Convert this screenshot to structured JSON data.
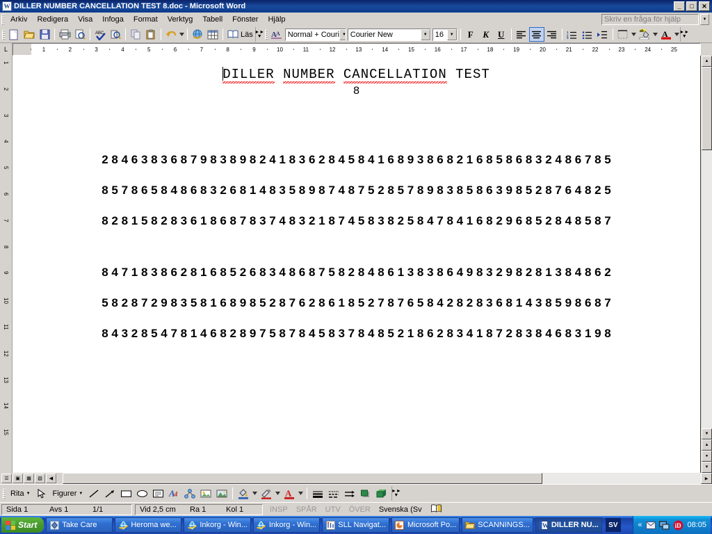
{
  "window": {
    "title": "DILLER NUMBER CANCELLATION TEST 8.doc - Microsoft Word",
    "app_icon": "word-icon",
    "minimize_label": "_",
    "maximize_label": "□",
    "close_label": "✕"
  },
  "menubar": {
    "items": [
      {
        "label": "Arkiv"
      },
      {
        "label": "Redigera"
      },
      {
        "label": "Visa"
      },
      {
        "label": "Infoga"
      },
      {
        "label": "Format"
      },
      {
        "label": "Verktyg"
      },
      {
        "label": "Tabell"
      },
      {
        "label": "Fönster"
      },
      {
        "label": "Hjälp"
      }
    ],
    "help_placeholder": "Skriv en fråga för hjälp"
  },
  "toolbar": {
    "buttons": [
      {
        "name": "new-document-icon",
        "glyph": "⬜"
      },
      {
        "name": "open-folder-icon",
        "glyph": "📂"
      },
      {
        "name": "save-icon",
        "glyph": "💾"
      },
      {
        "name": "print-icon",
        "glyph": "🖨"
      },
      {
        "name": "print-preview-icon",
        "glyph": "🔍"
      },
      {
        "name": "spelling-check-icon",
        "glyph": "✔"
      },
      {
        "name": "research-icon",
        "glyph": "🔬"
      },
      {
        "name": "copy-icon",
        "glyph": "⧉"
      },
      {
        "name": "paste-icon",
        "glyph": "📋"
      },
      {
        "name": "undo-icon",
        "glyph": "↶"
      },
      {
        "name": "hyperlink-icon",
        "glyph": "🌐"
      },
      {
        "name": "table-icon",
        "glyph": "▦"
      }
    ],
    "read_label": "Läs",
    "style_value": "Normal + Couri",
    "font_value": "Courier New",
    "size_value": "16",
    "bold_label": "F",
    "italic_label": "K",
    "underline_label": "U",
    "align_left": "≡",
    "align_center": "≡",
    "align_right": "≡",
    "numbered_list": "≣",
    "bullet_list": "☰",
    "indent": "⇥",
    "borders": "▦",
    "highlight": "ab",
    "font_color": "A",
    "active_alignment": "center"
  },
  "ruler": {
    "marks": [
      "1",
      "2",
      "3",
      "4",
      "5",
      "6",
      "7",
      "8",
      "9",
      "10",
      "11",
      "12",
      "13",
      "14",
      "15",
      "16",
      "17",
      "18",
      "19",
      "20",
      "21",
      "22",
      "23",
      "24",
      "25"
    ],
    "vertical_marks": [
      "1",
      "2",
      "3",
      "4",
      "5",
      "6",
      "7",
      "8",
      "9",
      "10",
      "11",
      "12",
      "13",
      "14",
      "15"
    ]
  },
  "document": {
    "title_words": [
      {
        "text": "DILLER",
        "misspelled": true
      },
      {
        "text": "NUMBER",
        "misspelled": true
      },
      {
        "text": "CANCELLATION",
        "misspelled": true
      },
      {
        "text": "TEST",
        "misspelled": false
      }
    ],
    "title_plain": "DILLER NUMBER CANCELLATION TEST",
    "subtitle": "8",
    "rows": [
      "2 8 4 6 3 8 3 6 8 7 9 8 3 8 9 8 2 4 1 8 3 6 2 8 4 5 8 4 1 6 8 9 3 8 6 8 2 1 6 8 5 8 6 8 3 2 4 8 6 7 8 5",
      "8 5 7 8 6 5 8 4 8 6 8 3 2 6 8 1 4 8 3 5 8 9 8 7 4 8 7 5 2 8 5 7 8 9 8 3 8 5 8 6 3 9 8 5 2 8 7 6 4 8 2 5",
      "8 2 8 1 5 8 2 8 3 6 1 8 6 8 7 8 3 7 4 8 3 2 1 8 7 4 5 8 3 8 2 5 8 4 7 8 4 1 6 8 2 9 6 8 5 2 8 4 8 5 8 7",
      "8 4 7 1 8 3 8 6 2 8 1 6 8 5 2 6 8 3 4 8 6 8 7 5 8 2 8 4 8 6 1 3 8 3 8 6 4 9 8 3 2 9 8 2 8 1 3 8 4 8 6 2",
      "5 8 2 8 7 2 9 8 3 5 8 1 6 8 9 8 5 2 8 7 6 2 8 6 1 8 5 2 7 8 7 6 5 8 4 2 8 2 8 3 6 8 1 4 3 8 5 9 8 6 8 7",
      "8 4 3 2 8 5 4 7 8 1 4 6 8 2 8 9 7 5 8 7 8 4 5 8 3 7 8 4 8 5 2 1 8 6 2 8 3 4 1 8 7 2 8 3 8 4 6 8 3 1 9 8"
    ]
  },
  "drawing_toolbar": {
    "draw_label": "Rita",
    "shapes_label": "Figurer",
    "tools": [
      {
        "name": "select-arrow-icon",
        "glyph": "↖"
      },
      {
        "name": "line-icon",
        "glyph": "╲"
      },
      {
        "name": "arrow-icon",
        "glyph": "→"
      },
      {
        "name": "rectangle-icon",
        "glyph": "▭"
      },
      {
        "name": "oval-icon",
        "glyph": "◯"
      },
      {
        "name": "textbox-icon",
        "glyph": "▤"
      },
      {
        "name": "wordart-icon",
        "glyph": "𝑨"
      },
      {
        "name": "diagram-icon",
        "glyph": "⊞"
      },
      {
        "name": "clipart-icon",
        "glyph": "🖼"
      },
      {
        "name": "picture-icon",
        "glyph": "🏞"
      },
      {
        "name": "fill-color-icon",
        "glyph": "🪣"
      },
      {
        "name": "line-color-icon",
        "glyph": "✎"
      },
      {
        "name": "font-color-icon",
        "glyph": "A"
      },
      {
        "name": "line-style-icon",
        "glyph": "≡"
      },
      {
        "name": "dash-style-icon",
        "glyph": "☰"
      },
      {
        "name": "arrow-style-icon",
        "glyph": "⇥"
      },
      {
        "name": "shadow-style-icon",
        "glyph": "■"
      },
      {
        "name": "3d-style-icon",
        "glyph": "▣"
      }
    ]
  },
  "statusbar": {
    "page": "Sida 1",
    "section": "Avs 1",
    "pages": "1/1",
    "at": "Vid 2,5 cm",
    "line": "Ra 1",
    "column": "Kol 1",
    "insp": "INSP",
    "spar": "SPÅR",
    "utv": "UTV",
    "over": "ÖVER",
    "language": "Svenska (Sv",
    "spell_icon": "book-icon"
  },
  "taskbar": {
    "start_label": "Start",
    "items": [
      {
        "label": "Take Care",
        "icon": "takecare-icon",
        "active": false
      },
      {
        "label": "Heroma we...",
        "icon": "internet-explorer-icon",
        "active": false
      },
      {
        "label": "Inkorg - Win...",
        "icon": "internet-explorer-icon",
        "active": false
      },
      {
        "label": "Inkorg - Win...",
        "icon": "internet-explorer-icon",
        "active": false
      },
      {
        "label": "SLL Navigat...",
        "icon": "sll-icon",
        "active": false
      },
      {
        "label": "Microsoft Po...",
        "icon": "powerpoint-icon",
        "active": false
      },
      {
        "label": "SCANNINGS...",
        "icon": "folder-icon",
        "active": false
      },
      {
        "label": "DILLER NU...",
        "icon": "word-icon",
        "active": true
      }
    ],
    "language_indicator": "SV",
    "tray": {
      "expand": "«",
      "icons": [
        {
          "name": "mail-tray-icon",
          "glyph": "✉"
        },
        {
          "name": "network-tray-icon",
          "glyph": "🖧"
        },
        {
          "name": "id-tray-icon",
          "glyph": "iD"
        }
      ],
      "clock": "08:05"
    }
  },
  "colors": {
    "titlebar_start": "#0a246a",
    "chrome": "#d6d3ce",
    "page_bg": "#ffffff",
    "desktop": "#808080",
    "accent": "#316ac5",
    "spell_error": "#ee0000"
  }
}
